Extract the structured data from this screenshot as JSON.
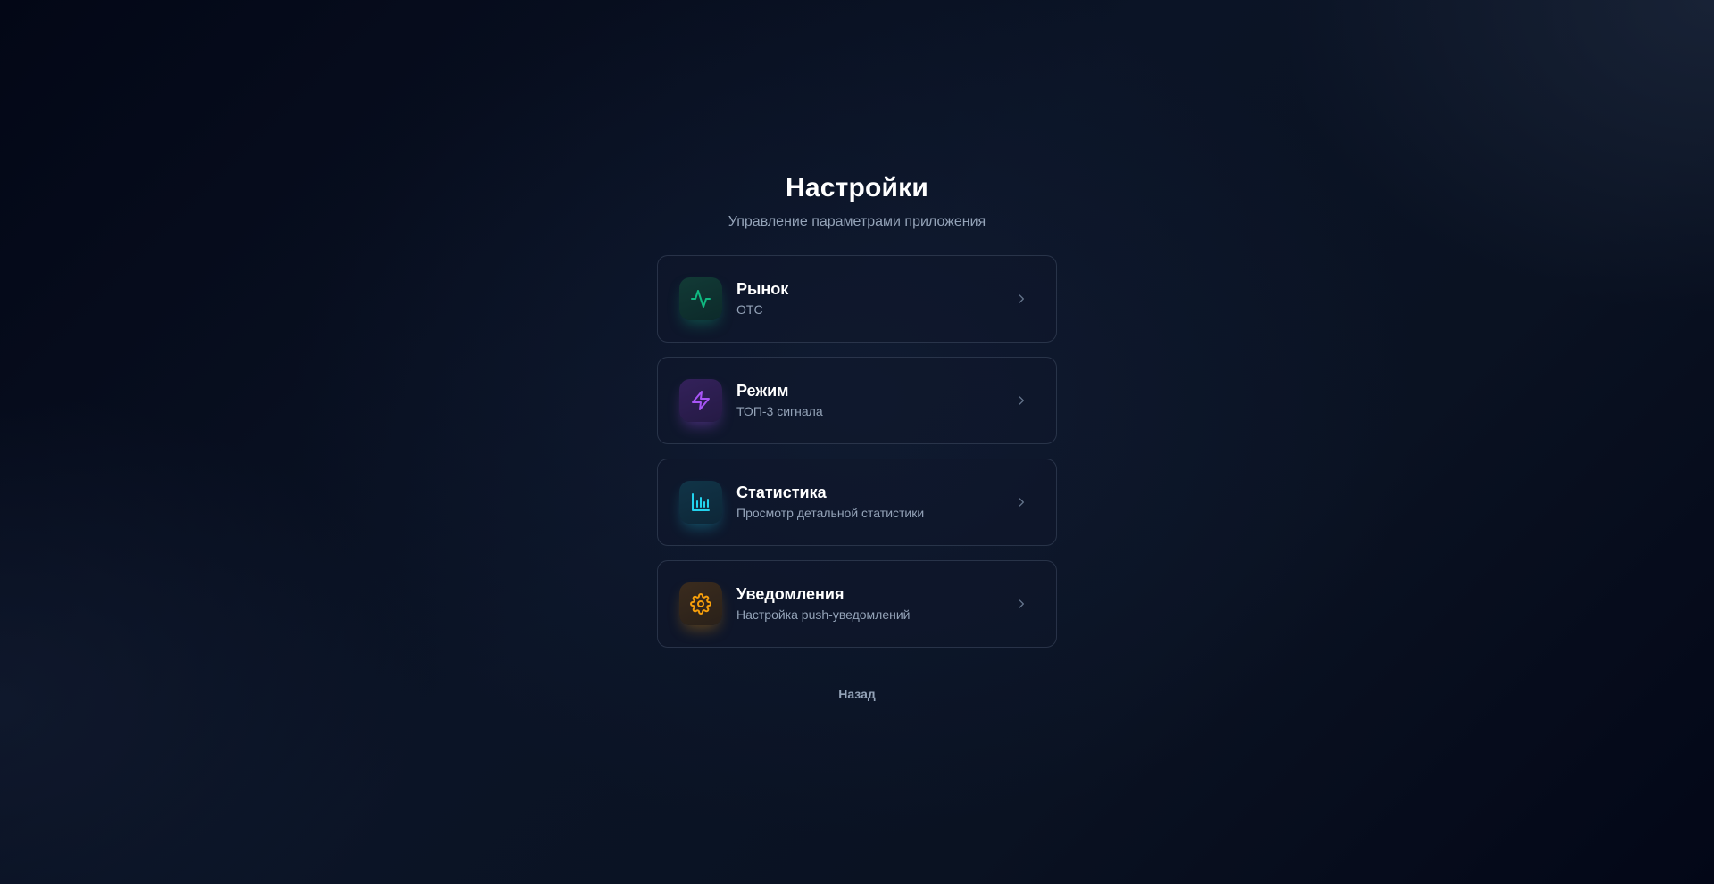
{
  "page": {
    "title": "Настройки",
    "subtitle": "Управление параметрами приложения"
  },
  "menu": {
    "items": [
      {
        "title": "Рынок",
        "subtitle": "OTC",
        "icon": "activity-icon",
        "accent": "#10b981"
      },
      {
        "title": "Режим",
        "subtitle": "ТОП-3 сигнала",
        "icon": "zap-icon",
        "accent": "#a855f7"
      },
      {
        "title": "Статистика",
        "subtitle": "Просмотр детальной статистики",
        "icon": "bar-chart-icon",
        "accent": "#22d3ee"
      },
      {
        "title": "Уведомления",
        "subtitle": "Настройка push-уведомлений",
        "icon": "gear-icon",
        "accent": "#f59e0b"
      }
    ]
  },
  "footer": {
    "back_label": "Назад"
  },
  "colors": {
    "background": "#0a1222",
    "muted_text": "#94a3b8",
    "card_border": "#334155"
  }
}
